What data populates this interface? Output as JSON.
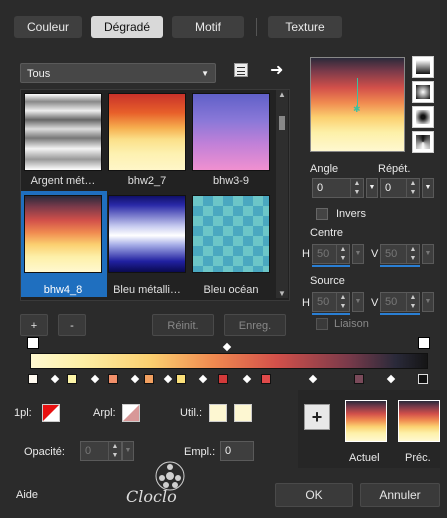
{
  "tabs": [
    {
      "label": "Couleur"
    },
    {
      "label": "Dégradé"
    },
    {
      "label": "Motif"
    },
    {
      "label": "Texture"
    }
  ],
  "category": {
    "value": "Tous"
  },
  "gradients": [
    {
      "name": "Argent mét…"
    },
    {
      "name": "bhw2_7"
    },
    {
      "name": "bhw3-9"
    },
    {
      "name": "bhw4_8"
    },
    {
      "name": "Bleu métalli…"
    },
    {
      "name": "Bleu océan"
    }
  ],
  "list_buttons": {
    "add": "+",
    "remove": "-",
    "reset": "Réinit.",
    "save": "Enreg."
  },
  "angle": {
    "label": "Angle",
    "value": "0"
  },
  "repeat": {
    "label": "Répét.",
    "value": "0"
  },
  "invert": {
    "label": "Invers",
    "checked": false
  },
  "center": {
    "label": "Centre",
    "h_label": "H",
    "h": "50",
    "v_label": "V",
    "v": "50"
  },
  "source": {
    "label": "Source",
    "h_label": "H",
    "h": "50",
    "v_label": "V",
    "v": "50"
  },
  "link": {
    "label": "Liaison"
  },
  "bottom": {
    "first_label": "1pl:",
    "arpl_label": "Arpl:",
    "util_label": "Util.:",
    "opacity_label": "Opacité:",
    "opacity_value": "0",
    "empl_label": "Empl.:",
    "empl_value": "0"
  },
  "preview": {
    "current_label": "Actuel",
    "previous_label": "Préc."
  },
  "footer": {
    "help": "Aide",
    "ok": "OK",
    "cancel": "Annuler"
  },
  "colors": {
    "accent": "#2a7fd4",
    "selected_stop": "#e81010",
    "util_color": "#fdf7d2"
  }
}
